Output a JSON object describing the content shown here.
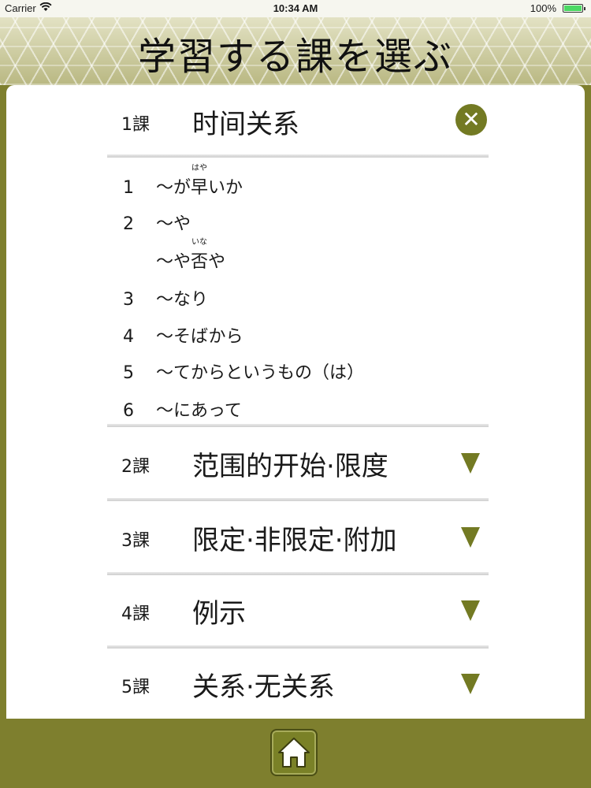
{
  "status_bar": {
    "carrier": "Carrier",
    "time": "10:34 AM",
    "battery": "100%"
  },
  "header": {
    "title": "学習する課を選ぶ"
  },
  "lessons": [
    {
      "number": "1課",
      "name": "时间关系",
      "expanded": true,
      "items": [
        {
          "num": "1",
          "pre": "～が",
          "ruby_base": "早",
          "ruby_text": "はや",
          "post": "いか"
        },
        {
          "num": "2",
          "text": "～や"
        },
        {
          "num": "",
          "pre": "～や",
          "ruby_base": "否",
          "ruby_text": "いな",
          "post": "や"
        },
        {
          "num": "3",
          "text": "～なり"
        },
        {
          "num": "4",
          "text": "～そばから"
        },
        {
          "num": "5",
          "text": "～てからというもの（は）"
        },
        {
          "num": "6",
          "text": "～にあって"
        }
      ]
    },
    {
      "number": "2課",
      "name": "范围的开始·限度",
      "expanded": false
    },
    {
      "number": "3課",
      "name": "限定·非限定·附加",
      "expanded": false
    },
    {
      "number": "4課",
      "name": "例示",
      "expanded": false
    },
    {
      "number": "5課",
      "name": "关系·无关系",
      "expanded": false
    }
  ],
  "colors": {
    "accent": "#737a23",
    "background": "#7e7f2e"
  },
  "icons": {
    "close": "close-icon",
    "expand": "triangle-down-icon",
    "home": "home-icon"
  }
}
